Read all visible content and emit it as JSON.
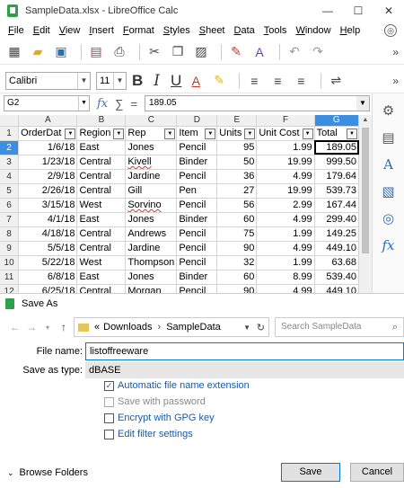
{
  "window": {
    "title": "SampleData.xlsx - LibreOffice Calc",
    "minimize": "—",
    "maximize": "☐",
    "close": "✕"
  },
  "menu": {
    "items": [
      "File",
      "Edit",
      "View",
      "Insert",
      "Format",
      "Styles",
      "Sheet",
      "Data",
      "Tools",
      "Window",
      "Help"
    ],
    "extra": "⚙"
  },
  "toolbar1": {
    "icons": [
      "new-icon",
      "open-icon",
      "save-icon",
      "export-pdf-icon",
      "print-icon",
      "cut-icon",
      "copy-icon",
      "paste-icon",
      "clone-formatting-icon",
      "clear-formatting-icon",
      "undo-icon",
      "redo-icon"
    ],
    "more": "»"
  },
  "toolbar2": {
    "font_name": "Calibri",
    "font_size": "11",
    "bold": "B",
    "italic": "I",
    "underline": "U",
    "more": "»"
  },
  "formula": {
    "cell_ref": "G2",
    "fx": "fx",
    "sum": "∑",
    "equals": "=",
    "content": "189.05"
  },
  "sheet": {
    "columns": [
      "A",
      "B",
      "C",
      "D",
      "E",
      "F",
      "G"
    ],
    "header_row": {
      "num": "1",
      "cells": [
        "OrderDat",
        "Region",
        "Rep",
        "Item",
        "Units",
        "Unit Cost",
        "Total"
      ]
    },
    "rows": [
      {
        "num": "2",
        "cells": [
          "1/6/18",
          "East",
          "Jones",
          "Pencil",
          "95",
          "1.99",
          "189.05"
        ]
      },
      {
        "num": "3",
        "cells": [
          "1/23/18",
          "Central",
          "Kivell",
          "Binder",
          "50",
          "19.99",
          "999.50"
        ]
      },
      {
        "num": "4",
        "cells": [
          "2/9/18",
          "Central",
          "Jardine",
          "Pencil",
          "36",
          "4.99",
          "179.64"
        ]
      },
      {
        "num": "5",
        "cells": [
          "2/26/18",
          "Central",
          "Gill",
          "Pen",
          "27",
          "19.99",
          "539.73"
        ]
      },
      {
        "num": "6",
        "cells": [
          "3/15/18",
          "West",
          "Sorvino",
          "Pencil",
          "56",
          "2.99",
          "167.44"
        ]
      },
      {
        "num": "7",
        "cells": [
          "4/1/18",
          "East",
          "Jones",
          "Binder",
          "60",
          "4.99",
          "299.40"
        ]
      },
      {
        "num": "8",
        "cells": [
          "4/18/18",
          "Central",
          "Andrews",
          "Pencil",
          "75",
          "1.99",
          "149.25"
        ]
      },
      {
        "num": "9",
        "cells": [
          "5/5/18",
          "Central",
          "Jardine",
          "Pencil",
          "90",
          "4.99",
          "449.10"
        ]
      },
      {
        "num": "10",
        "cells": [
          "5/22/18",
          "West",
          "Thompson",
          "Pencil",
          "32",
          "1.99",
          "63.68"
        ]
      },
      {
        "num": "11",
        "cells": [
          "6/8/18",
          "East",
          "Jones",
          "Binder",
          "60",
          "8.99",
          "539.40"
        ]
      },
      {
        "num": "12",
        "cells": [
          "6/25/18",
          "Central",
          "Morgan",
          "Pencil",
          "90",
          "4.99",
          "449.10"
        ]
      }
    ],
    "selected_column": "G",
    "selected_row": "2"
  },
  "sidebar": {
    "icons": [
      "properties-icon",
      "styles-icon",
      "gallery-icon",
      "navigator-icon",
      "functions-icon"
    ]
  },
  "dialog": {
    "title": "Save As",
    "path": {
      "prefix": "«",
      "crumb1": "Downloads",
      "crumb2": "SampleData"
    },
    "search_placeholder": "Search SampleData",
    "file_name_label": "File name:",
    "file_name_value": "listoffreeware",
    "save_type_label": "Save as type:",
    "save_type_value": "dBASE",
    "options": [
      {
        "label": "Automatic file name extension",
        "checked": true,
        "enabled": true
      },
      {
        "label": "Save with password",
        "checked": false,
        "enabled": false
      },
      {
        "label": "Encrypt with GPG key",
        "checked": false,
        "enabled": true
      },
      {
        "label": "Edit filter settings",
        "checked": false,
        "enabled": true
      }
    ],
    "browse_folders": "Browse Folders",
    "save_button": "Save",
    "cancel_button": "Cancel"
  }
}
